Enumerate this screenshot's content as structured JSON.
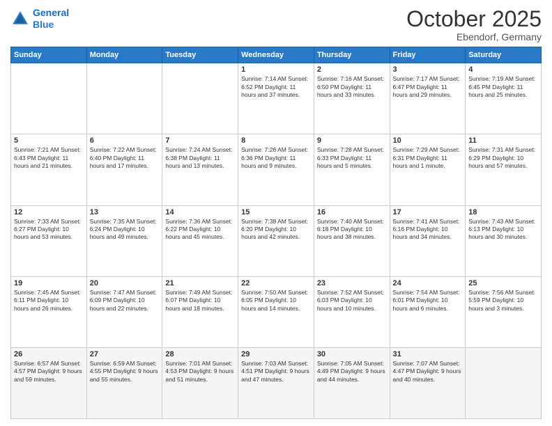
{
  "header": {
    "logo_line1": "General",
    "logo_line2": "Blue",
    "month": "October 2025",
    "location": "Ebendorf, Germany"
  },
  "weekdays": [
    "Sunday",
    "Monday",
    "Tuesday",
    "Wednesday",
    "Thursday",
    "Friday",
    "Saturday"
  ],
  "weeks": [
    [
      {
        "day": "",
        "info": ""
      },
      {
        "day": "",
        "info": ""
      },
      {
        "day": "",
        "info": ""
      },
      {
        "day": "1",
        "info": "Sunrise: 7:14 AM\nSunset: 6:52 PM\nDaylight: 11 hours\nand 37 minutes."
      },
      {
        "day": "2",
        "info": "Sunrise: 7:16 AM\nSunset: 6:50 PM\nDaylight: 11 hours\nand 33 minutes."
      },
      {
        "day": "3",
        "info": "Sunrise: 7:17 AM\nSunset: 6:47 PM\nDaylight: 11 hours\nand 29 minutes."
      },
      {
        "day": "4",
        "info": "Sunrise: 7:19 AM\nSunset: 6:45 PM\nDaylight: 11 hours\nand 25 minutes."
      }
    ],
    [
      {
        "day": "5",
        "info": "Sunrise: 7:21 AM\nSunset: 6:43 PM\nDaylight: 11 hours\nand 21 minutes."
      },
      {
        "day": "6",
        "info": "Sunrise: 7:22 AM\nSunset: 6:40 PM\nDaylight: 11 hours\nand 17 minutes."
      },
      {
        "day": "7",
        "info": "Sunrise: 7:24 AM\nSunset: 6:38 PM\nDaylight: 11 hours\nand 13 minutes."
      },
      {
        "day": "8",
        "info": "Sunrise: 7:26 AM\nSunset: 6:36 PM\nDaylight: 11 hours\nand 9 minutes."
      },
      {
        "day": "9",
        "info": "Sunrise: 7:28 AM\nSunset: 6:33 PM\nDaylight: 11 hours\nand 5 minutes."
      },
      {
        "day": "10",
        "info": "Sunrise: 7:29 AM\nSunset: 6:31 PM\nDaylight: 11 hours\nand 1 minute."
      },
      {
        "day": "11",
        "info": "Sunrise: 7:31 AM\nSunset: 6:29 PM\nDaylight: 10 hours\nand 57 minutes."
      }
    ],
    [
      {
        "day": "12",
        "info": "Sunrise: 7:33 AM\nSunset: 6:27 PM\nDaylight: 10 hours\nand 53 minutes."
      },
      {
        "day": "13",
        "info": "Sunrise: 7:35 AM\nSunset: 6:24 PM\nDaylight: 10 hours\nand 49 minutes."
      },
      {
        "day": "14",
        "info": "Sunrise: 7:36 AM\nSunset: 6:22 PM\nDaylight: 10 hours\nand 45 minutes."
      },
      {
        "day": "15",
        "info": "Sunrise: 7:38 AM\nSunset: 6:20 PM\nDaylight: 10 hours\nand 42 minutes."
      },
      {
        "day": "16",
        "info": "Sunrise: 7:40 AM\nSunset: 6:18 PM\nDaylight: 10 hours\nand 38 minutes."
      },
      {
        "day": "17",
        "info": "Sunrise: 7:41 AM\nSunset: 6:16 PM\nDaylight: 10 hours\nand 34 minutes."
      },
      {
        "day": "18",
        "info": "Sunrise: 7:43 AM\nSunset: 6:13 PM\nDaylight: 10 hours\nand 30 minutes."
      }
    ],
    [
      {
        "day": "19",
        "info": "Sunrise: 7:45 AM\nSunset: 6:11 PM\nDaylight: 10 hours\nand 26 minutes."
      },
      {
        "day": "20",
        "info": "Sunrise: 7:47 AM\nSunset: 6:09 PM\nDaylight: 10 hours\nand 22 minutes."
      },
      {
        "day": "21",
        "info": "Sunrise: 7:49 AM\nSunset: 6:07 PM\nDaylight: 10 hours\nand 18 minutes."
      },
      {
        "day": "22",
        "info": "Sunrise: 7:50 AM\nSunset: 6:05 PM\nDaylight: 10 hours\nand 14 minutes."
      },
      {
        "day": "23",
        "info": "Sunrise: 7:52 AM\nSunset: 6:03 PM\nDaylight: 10 hours\nand 10 minutes."
      },
      {
        "day": "24",
        "info": "Sunrise: 7:54 AM\nSunset: 6:01 PM\nDaylight: 10 hours\nand 6 minutes."
      },
      {
        "day": "25",
        "info": "Sunrise: 7:56 AM\nSunset: 5:59 PM\nDaylight: 10 hours\nand 3 minutes."
      }
    ],
    [
      {
        "day": "26",
        "info": "Sunrise: 6:57 AM\nSunset: 4:57 PM\nDaylight: 9 hours\nand 59 minutes."
      },
      {
        "day": "27",
        "info": "Sunrise: 6:59 AM\nSunset: 4:55 PM\nDaylight: 9 hours\nand 55 minutes."
      },
      {
        "day": "28",
        "info": "Sunrise: 7:01 AM\nSunset: 4:53 PM\nDaylight: 9 hours\nand 51 minutes."
      },
      {
        "day": "29",
        "info": "Sunrise: 7:03 AM\nSunset: 4:51 PM\nDaylight: 9 hours\nand 47 minutes."
      },
      {
        "day": "30",
        "info": "Sunrise: 7:05 AM\nSunset: 4:49 PM\nDaylight: 9 hours\nand 44 minutes."
      },
      {
        "day": "31",
        "info": "Sunrise: 7:07 AM\nSunset: 4:47 PM\nDaylight: 9 hours\nand 40 minutes."
      },
      {
        "day": "",
        "info": ""
      }
    ]
  ]
}
